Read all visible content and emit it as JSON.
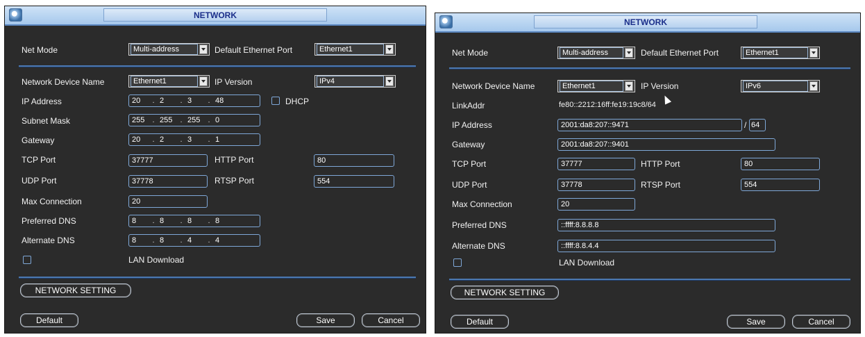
{
  "panels": [
    {
      "title": "NETWORK",
      "net_mode_label": "Net Mode",
      "net_mode_value": "Multi-address",
      "default_port_label": "Default Ethernet Port",
      "default_port_value": "Ethernet1",
      "device_name_label": "Network Device Name",
      "device_name_value": "Ethernet1",
      "ip_version_label": "IP Version",
      "ip_version_value": "IPv4",
      "ip_address_label": "IP Address",
      "ip_address": [
        "20",
        "2",
        "3",
        "48"
      ],
      "dhcp_label": "DHCP",
      "subnet_label": "Subnet Mask",
      "subnet": [
        "255",
        "255",
        "255",
        "0"
      ],
      "gateway_label": "Gateway",
      "gateway": [
        "20",
        "2",
        "3",
        "1"
      ],
      "tcp_label": "TCP Port",
      "tcp_value": "37777",
      "http_label": "HTTP Port",
      "http_value": "80",
      "udp_label": "UDP Port",
      "udp_value": "37778",
      "rtsp_label": "RTSP Port",
      "rtsp_value": "554",
      "max_conn_label": "Max Connection",
      "max_conn_value": "20",
      "pref_dns_label": "Preferred DNS",
      "pref_dns": [
        "8",
        "8",
        "8",
        "8"
      ],
      "alt_dns_label": "Alternate DNS",
      "alt_dns": [
        "8",
        "8",
        "4",
        "4"
      ],
      "lan_download_label": "LAN Download",
      "network_setting_label": "NETWORK SETTING",
      "default_button": "Default",
      "save_button": "Save",
      "cancel_button": "Cancel"
    },
    {
      "title": "NETWORK",
      "net_mode_label": "Net Mode",
      "net_mode_value": "Multi-address",
      "default_port_label": "Default Ethernet Port",
      "default_port_value": "Ethernet1",
      "device_name_label": "Network Device Name",
      "device_name_value": "Ethernet1",
      "ip_version_label": "IP Version",
      "ip_version_value": "IPv6",
      "linkaddr_label": "LinkAddr",
      "linkaddr_value": "fe80::2212:16ff:fe19:19c8/64",
      "ip_address_label": "IP Address",
      "ip_address_value": "2001:da8:207::9471",
      "prefix_separator": "/",
      "prefix_value": "64",
      "gateway_label": "Gateway",
      "gateway_value": "2001:da8:207::9401",
      "tcp_label": "TCP Port",
      "tcp_value": "37777",
      "http_label": "HTTP Port",
      "http_value": "80",
      "udp_label": "UDP Port",
      "udp_value": "37778",
      "rtsp_label": "RTSP Port",
      "rtsp_value": "554",
      "max_conn_label": "Max Connection",
      "max_conn_value": "20",
      "pref_dns_label": "Preferred DNS",
      "pref_dns_value": "::ffff:8.8.8.8",
      "alt_dns_label": "Alternate DNS",
      "alt_dns_value": "::ffff:8.8.4.4",
      "lan_download_label": "LAN Download",
      "network_setting_label": "NETWORK SETTING",
      "default_button": "Default",
      "save_button": "Save",
      "cancel_button": "Cancel"
    }
  ]
}
